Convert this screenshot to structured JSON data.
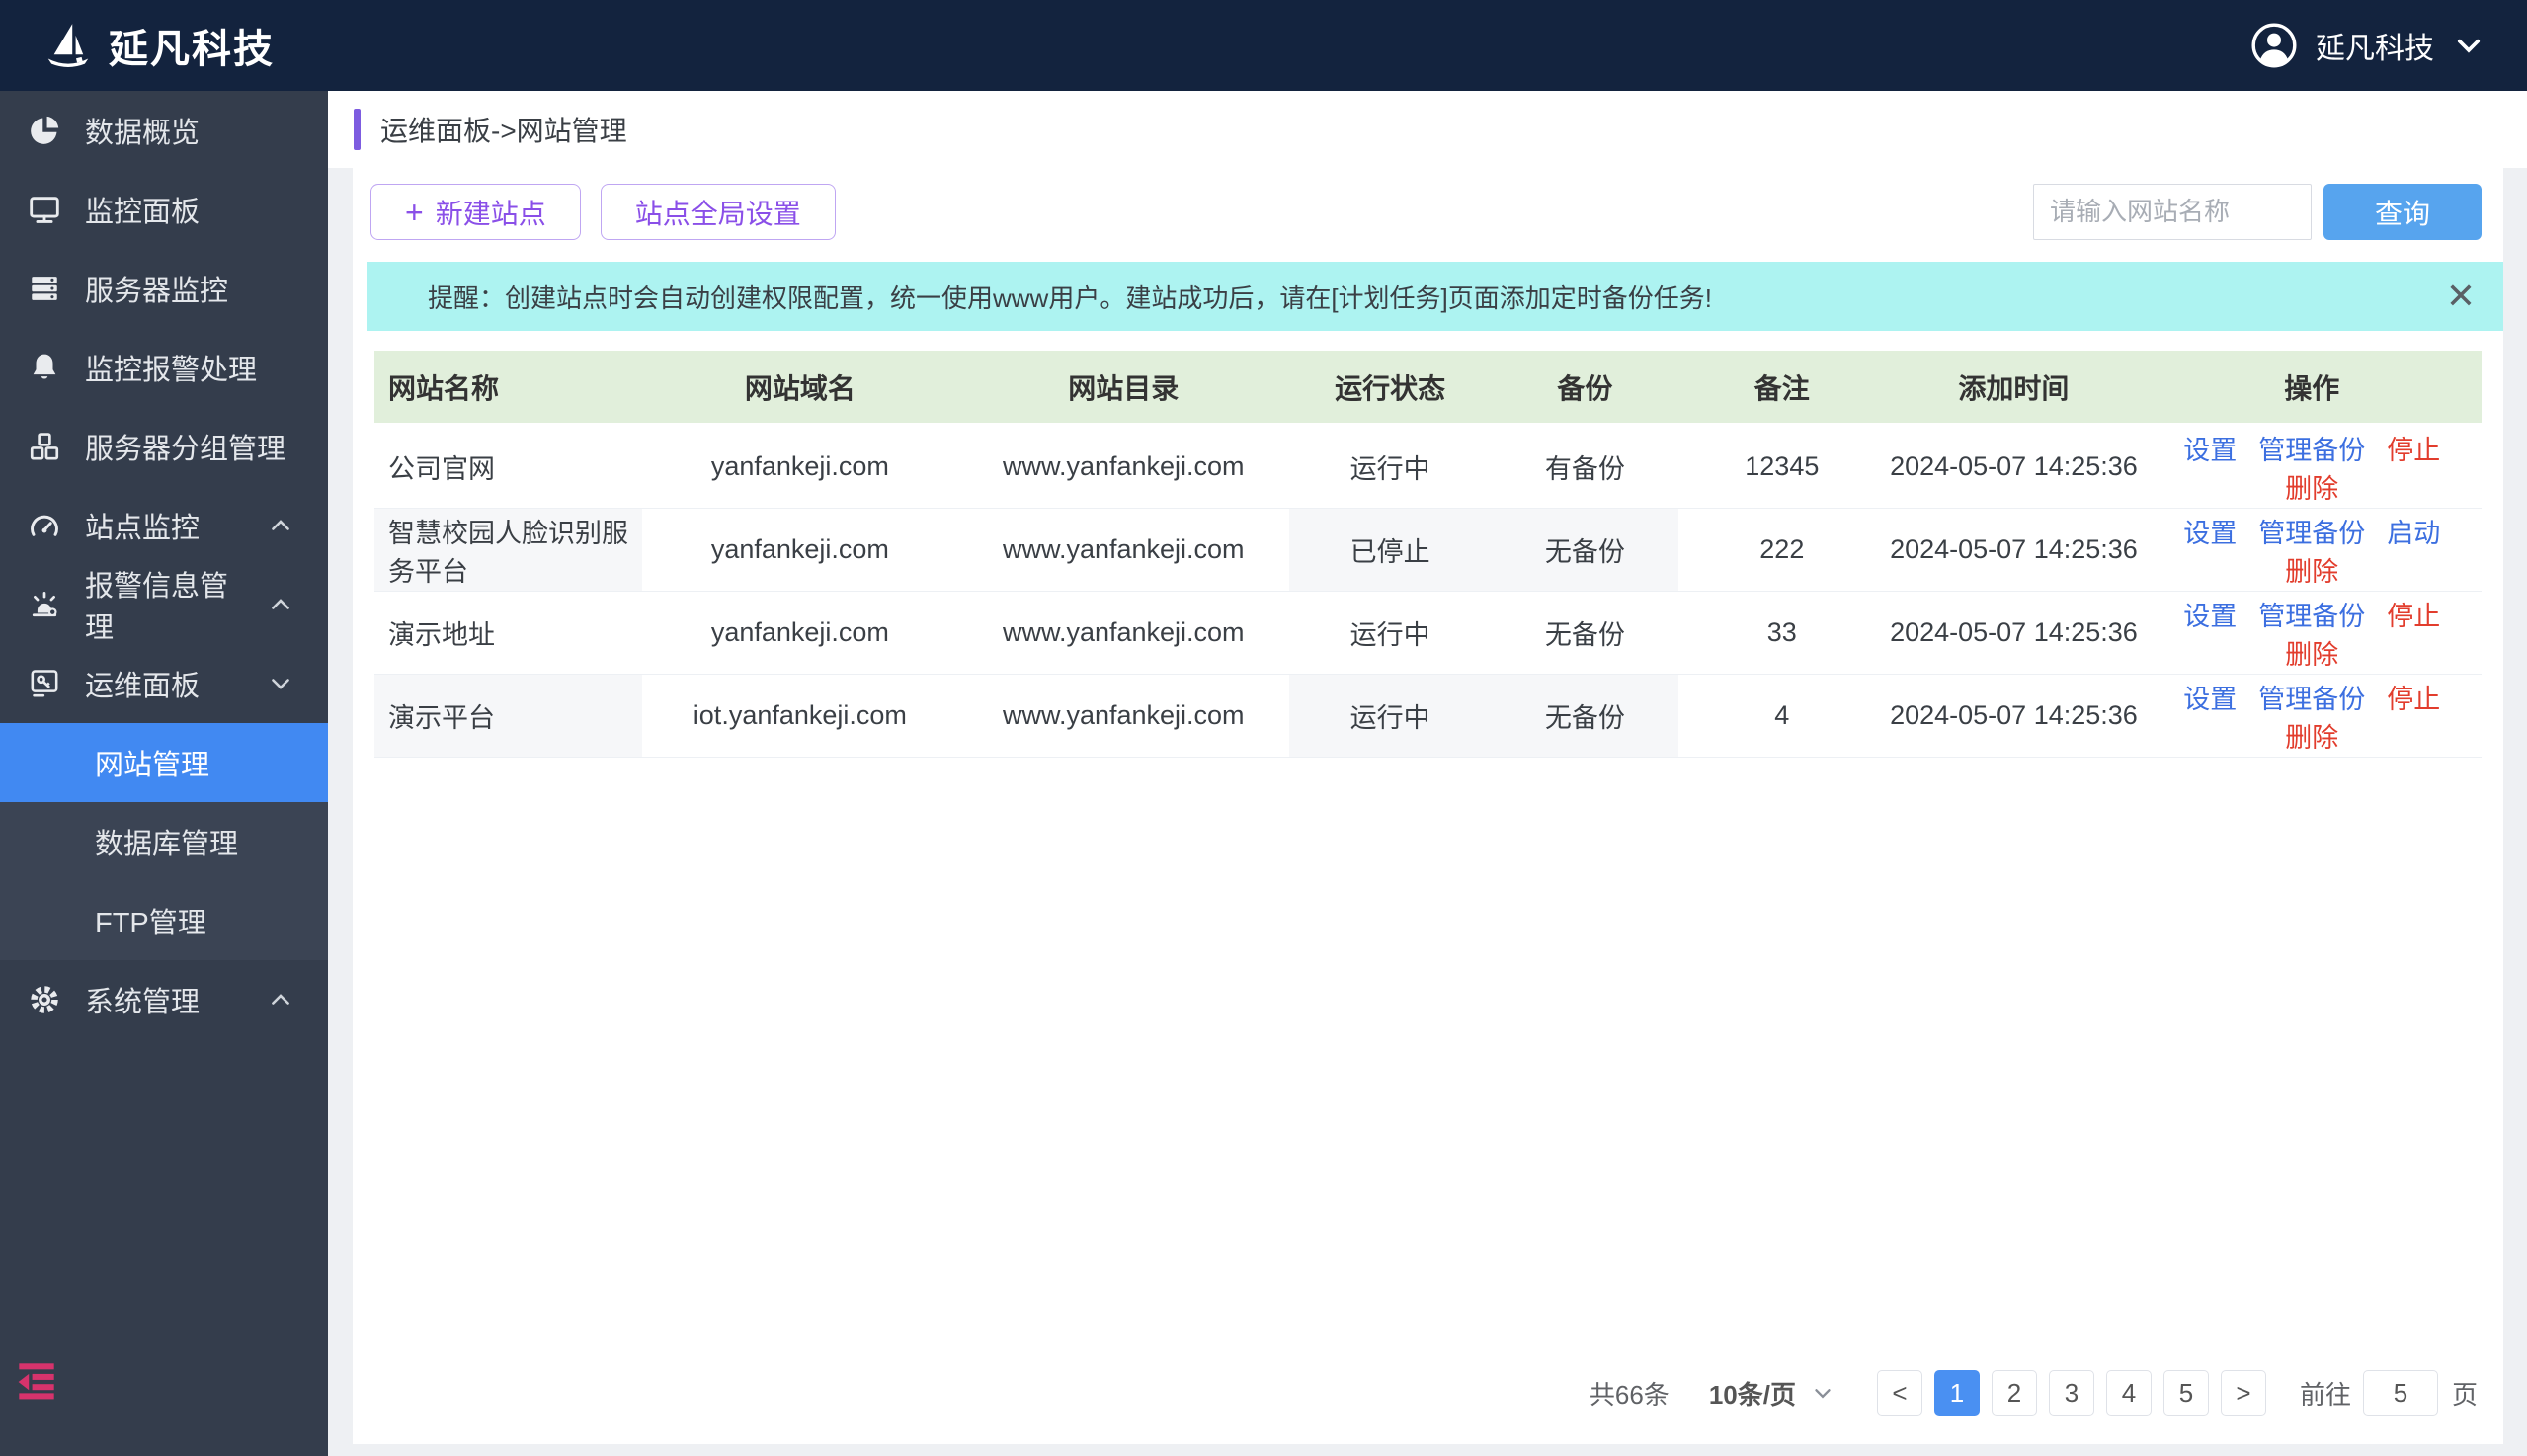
{
  "colors": {
    "header_bg": "#13233e",
    "sidebar_bg": "#343d4c",
    "sidebar_submenu_bg": "#3b4454",
    "active_menu_blue": "#4189f2",
    "accent_purple": "#7d5ce0",
    "button_purple": "#8a4fe8",
    "primary_blue": "#57a4ee",
    "alert_bg": "#adf3f1",
    "table_header_green": "#e1efdb",
    "link_blue": "#3c6fe0",
    "danger_red": "#e23d2d",
    "pagination_active_blue": "#4a90f2",
    "collapse_icon_pink": "#d6336c"
  },
  "header": {
    "brand": "延凡科技",
    "user_name": "延凡科技"
  },
  "breadcrumb": "运维面板->网站管理",
  "sidebar": {
    "items": [
      {
        "label": "数据概览",
        "icon": "pie-chart"
      },
      {
        "label": "监控面板",
        "icon": "monitor"
      },
      {
        "label": "服务器监控",
        "icon": "server"
      },
      {
        "label": "监控报警处理",
        "icon": "bell"
      },
      {
        "label": "服务器分组管理",
        "icon": "cubes"
      },
      {
        "label": "站点监控",
        "icon": "gauge",
        "chevron": "up"
      },
      {
        "label": "报警信息管理",
        "icon": "alarm-light",
        "chevron": "up"
      },
      {
        "label": "运维面板",
        "icon": "ops-panel",
        "chevron": "down",
        "children": [
          {
            "label": "网站管理",
            "active": true
          },
          {
            "label": "数据库管理",
            "active": false
          },
          {
            "label": "FTP管理",
            "active": false
          }
        ]
      },
      {
        "label": "系统管理",
        "icon": "gear",
        "chevron": "up"
      }
    ]
  },
  "toolbar": {
    "new_site": "新建站点",
    "global_settings": "站点全局设置",
    "search_placeholder": "请输入网站名称",
    "search_button": "查询"
  },
  "alert": {
    "text": "提醒：创建站点时会自动创建权限配置，统一使用www用户。建站成功后，请在[计划任务]页面添加定时备份任务!"
  },
  "table": {
    "columns": [
      "网站名称",
      "网站域名",
      "网站目录",
      "运行状态",
      "备份",
      "备注",
      "添加时间",
      "操作"
    ],
    "rows": [
      {
        "name": "公司官网",
        "domain": "yanfankeji.com",
        "directory": "www.yanfankeji.com",
        "status": "运行中",
        "backup": "有备份",
        "note": "12345",
        "added": "2024-05-07 14:25:36",
        "shaded": false,
        "actions": [
          {
            "label": "设置",
            "style": "blue"
          },
          {
            "label": "管理备份",
            "style": "blue"
          },
          {
            "label": "停止",
            "style": "red"
          },
          {
            "label": "删除",
            "style": "red"
          }
        ]
      },
      {
        "name": "智慧校园人脸识别服务平台",
        "domain": "yanfankeji.com",
        "directory": "www.yanfankeji.com",
        "status": "已停止",
        "backup": "无备份",
        "note": "222",
        "added": "2024-05-07 14:25:36",
        "shaded": true,
        "actions": [
          {
            "label": "设置",
            "style": "blue"
          },
          {
            "label": "管理备份",
            "style": "blue"
          },
          {
            "label": "启动",
            "style": "blue"
          },
          {
            "label": "删除",
            "style": "red"
          }
        ]
      },
      {
        "name": "演示地址",
        "domain": "yanfankeji.com",
        "directory": "www.yanfankeji.com",
        "status": "运行中",
        "backup": "无备份",
        "note": "33",
        "added": "2024-05-07 14:25:36",
        "shaded": false,
        "actions": [
          {
            "label": "设置",
            "style": "blue"
          },
          {
            "label": "管理备份",
            "style": "blue"
          },
          {
            "label": "停止",
            "style": "red"
          },
          {
            "label": "删除",
            "style": "red"
          }
        ]
      },
      {
        "name": "演示平台",
        "domain": "iot.yanfankeji.com",
        "directory": "www.yanfankeji.com",
        "status": "运行中",
        "backup": "无备份",
        "note": "4",
        "added": "2024-05-07 14:25:36",
        "shaded": true,
        "actions": [
          {
            "label": "设置",
            "style": "blue"
          },
          {
            "label": "管理备份",
            "style": "blue"
          },
          {
            "label": "停止",
            "style": "red"
          },
          {
            "label": "删除",
            "style": "red"
          }
        ]
      }
    ]
  },
  "pagination": {
    "total": "共66条",
    "page_size": "10条/页",
    "prev": "<",
    "next": ">",
    "pages": [
      "1",
      "2",
      "3",
      "4",
      "5"
    ],
    "active_page": "1",
    "goto_label": "前往",
    "goto_value": "5",
    "goto_suffix": "页"
  }
}
